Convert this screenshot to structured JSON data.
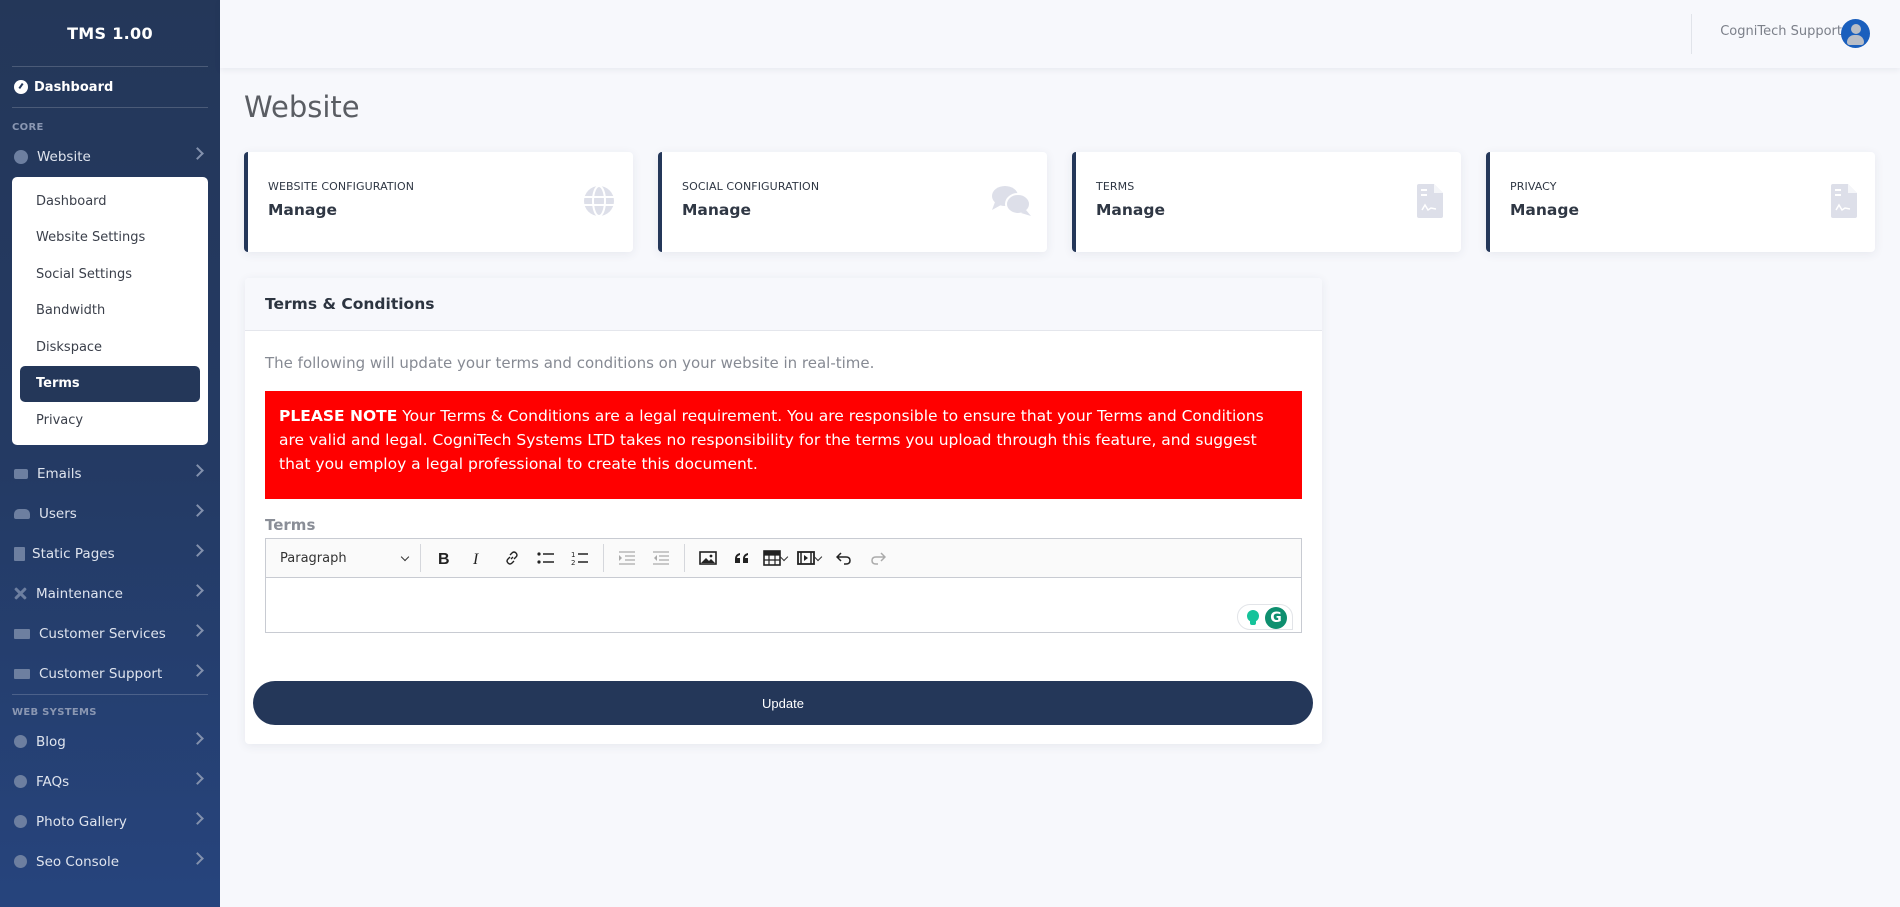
{
  "sidebar": {
    "brand": "TMS 1.00",
    "dashboard_label": "Dashboard",
    "sections": {
      "core": "CORE",
      "web_systems": "WEB SYSTEMS"
    },
    "website": {
      "label": "Website",
      "submenu": [
        "Dashboard",
        "Website Settings",
        "Social Settings",
        "Bandwidth",
        "Diskspace",
        "Terms",
        "Privacy"
      ],
      "active": "Terms"
    },
    "core_items": [
      {
        "label": "Emails",
        "icon": "envelope-icon"
      },
      {
        "label": "Users",
        "icon": "users-icon"
      },
      {
        "label": "Static Pages",
        "icon": "file-icon"
      },
      {
        "label": "Maintenance",
        "icon": "tools-icon"
      },
      {
        "label": "Customer Services",
        "icon": "ticket-icon"
      },
      {
        "label": "Customer Support",
        "icon": "ticket-icon"
      }
    ],
    "web_items": [
      {
        "label": "Blog",
        "icon": "gear-icon"
      },
      {
        "label": "FAQs",
        "icon": "gear-icon"
      },
      {
        "label": "Photo Gallery",
        "icon": "gear-icon"
      },
      {
        "label": "Seo Console",
        "icon": "gear-icon"
      }
    ]
  },
  "topbar": {
    "user_name": "CogniTech Support"
  },
  "main": {
    "title": "Website",
    "cards": [
      {
        "label": "WEBSITE CONFIGURATION",
        "value": "Manage",
        "icon": "globe-icon"
      },
      {
        "label": "SOCIAL CONFIGURATION",
        "value": "Manage",
        "icon": "comments-icon"
      },
      {
        "label": "TERMS",
        "value": "Manage",
        "icon": "file-contract-icon"
      },
      {
        "label": "PRIVACY",
        "value": "Manage",
        "icon": "file-contract-icon"
      }
    ],
    "panel": {
      "title": "Terms & Conditions",
      "intro": "The following will update your terms and conditions on your website in real-time.",
      "alert_strong": "PLEASE NOTE",
      "alert_text": " Your Terms & Conditions are a legal requirement. You are responsible to ensure that your Terms and Conditions are valid and legal. CogniTech Systems LTD takes no responsibility for the terms you upload through this feature, and suggest that you employ a legal professional to create this document.",
      "field_label": "Terms",
      "editor": {
        "block_format": "Paragraph",
        "content": ""
      },
      "submit_label": "Update"
    }
  },
  "colors": {
    "sidebar": "#243759",
    "accent": "#243759",
    "alert": "#ff0000",
    "avatar": "#1a5fbd"
  }
}
